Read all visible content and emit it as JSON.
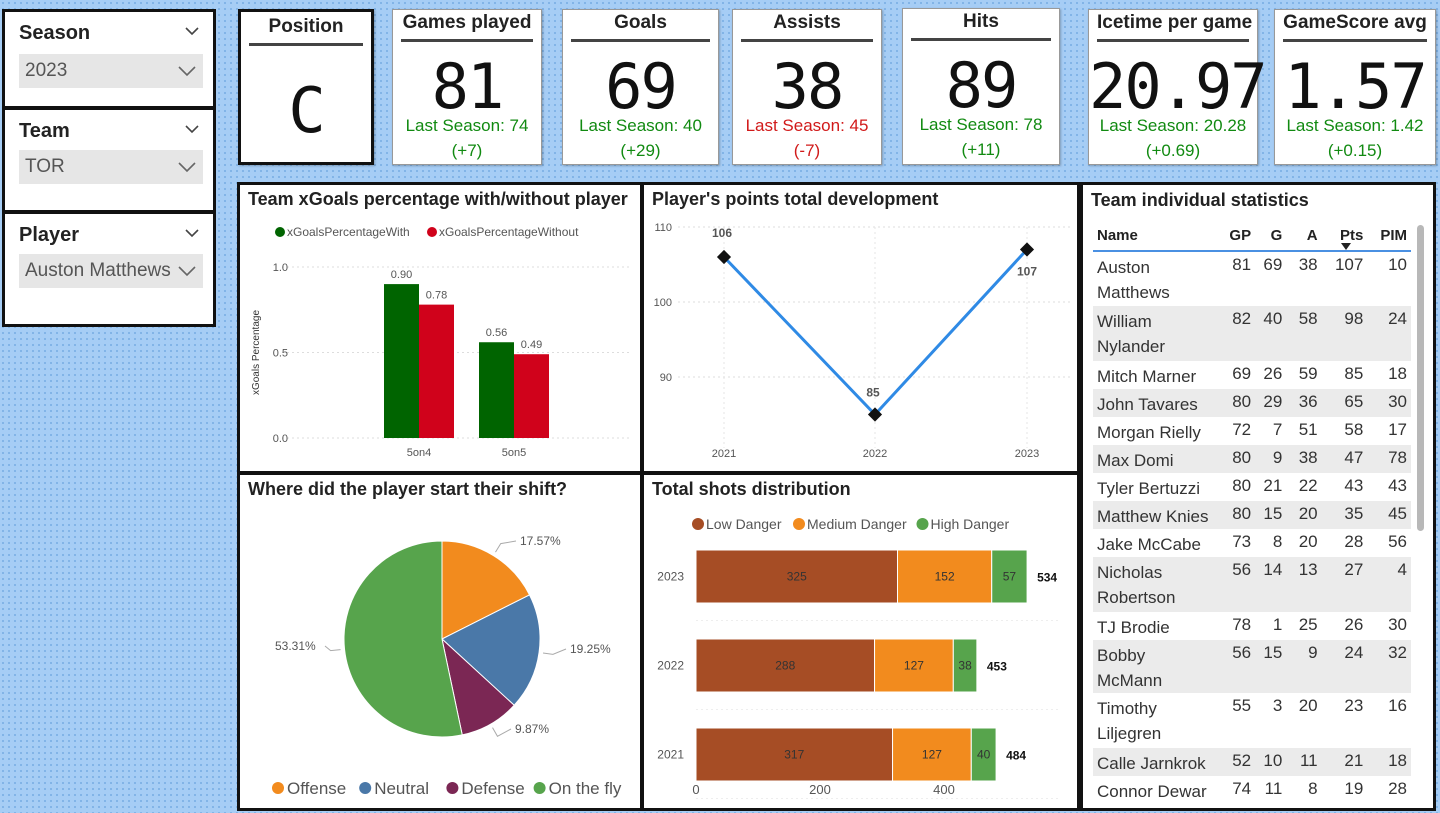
{
  "slicers": {
    "season": {
      "title": "Season",
      "value": "2023"
    },
    "team": {
      "title": "Team",
      "value": "TOR"
    },
    "player": {
      "title": "Player",
      "value": "Auston Matthews"
    }
  },
  "kpis": {
    "position": {
      "title": "Position",
      "value": "C"
    },
    "games": {
      "title": "Games played",
      "value": "81",
      "last": "Last Season: 74",
      "delta": "(+7)",
      "color": "#118a11"
    },
    "goals": {
      "title": "Goals",
      "value": "69",
      "last": "Last Season: 40",
      "delta": "(+29)",
      "color": "#118a11"
    },
    "assists": {
      "title": "Assists",
      "value": "38",
      "last": "Last Season: 45",
      "delta": "(-7)",
      "color": "#d11a1a"
    },
    "hits": {
      "title": "Hits",
      "value": "89",
      "last": "Last Season: 78",
      "delta": "(+11)",
      "color": "#118a11"
    },
    "icetime": {
      "title": "Icetime per game",
      "value": "20.97",
      "last": "Last Season: 20.28",
      "delta": "(+0.69)",
      "color": "#118a11"
    },
    "gamescore": {
      "title": "GameScore avg",
      "value": "1.57",
      "last": "Last Season: 1.42",
      "delta": "(+0.15)",
      "color": "#118a11"
    }
  },
  "table": {
    "title": "Team individual statistics",
    "columns": [
      "Name",
      "GP",
      "G",
      "A",
      "Pts",
      "PIM"
    ],
    "sort_column": "Pts",
    "rows": [
      [
        "Auston Matthews",
        "81",
        "69",
        "38",
        "107",
        "10"
      ],
      [
        "William Nylander",
        "82",
        "40",
        "58",
        "98",
        "24"
      ],
      [
        "Mitch Marner",
        "69",
        "26",
        "59",
        "85",
        "18"
      ],
      [
        "John Tavares",
        "80",
        "29",
        "36",
        "65",
        "30"
      ],
      [
        "Morgan Rielly",
        "72",
        "7",
        "51",
        "58",
        "17"
      ],
      [
        "Max Domi",
        "80",
        "9",
        "38",
        "47",
        "78"
      ],
      [
        "Tyler Bertuzzi",
        "80",
        "21",
        "22",
        "43",
        "43"
      ],
      [
        "Matthew Knies",
        "80",
        "15",
        "20",
        "35",
        "45"
      ],
      [
        "Jake McCabe",
        "73",
        "8",
        "20",
        "28",
        "56"
      ],
      [
        "Nicholas Robertson",
        "56",
        "14",
        "13",
        "27",
        "4"
      ],
      [
        "TJ Brodie",
        "78",
        "1",
        "25",
        "26",
        "30"
      ],
      [
        "Bobby McMann",
        "56",
        "15",
        "9",
        "24",
        "32"
      ],
      [
        "Timothy Liljegren",
        "55",
        "3",
        "20",
        "23",
        "16"
      ],
      [
        "Calle Jarnkrok",
        "52",
        "10",
        "11",
        "21",
        "18"
      ],
      [
        "Connor Dewar",
        "74",
        "11",
        "8",
        "19",
        "28"
      ]
    ]
  },
  "chart_data": [
    {
      "type": "bar",
      "title": "Team xGoals percentage with/without player",
      "ylabel": "xGoals Percentage",
      "xlabel": "",
      "categories": [
        "5on4",
        "5on5"
      ],
      "series": [
        {
          "name": "xGoalsPercentageWith",
          "color": "#006400",
          "values": [
            0.9,
            0.56
          ],
          "labels": [
            "0.90",
            "0.56"
          ]
        },
        {
          "name": "xGoalsPercentageWithout",
          "color": "#d0021b",
          "values": [
            0.78,
            0.49
          ],
          "labels": [
            "0.78",
            "0.49"
          ]
        }
      ],
      "ylim": [
        0,
        1.0
      ],
      "yticks": [
        "0.0",
        "0.5",
        "1.0"
      ],
      "legend": "top",
      "grid": true
    },
    {
      "type": "line",
      "title": "Player's points total development",
      "x": [
        "2021",
        "2022",
        "2023"
      ],
      "series": [
        {
          "color": "#2f8ae5",
          "values": [
            106,
            85,
            107
          ],
          "labels": [
            "106",
            "85",
            "107"
          ]
        }
      ],
      "ylim": [
        80,
        110
      ],
      "yticks": [
        "90",
        "100",
        "110"
      ],
      "grid": true
    },
    {
      "type": "pie",
      "title": "Where did the player start their shift?",
      "slices": [
        {
          "name": "Offense",
          "value": 17.57,
          "label": "17.57%",
          "color": "#f28b1e"
        },
        {
          "name": "Neutral",
          "value": 19.25,
          "label": "19.25%",
          "color": "#4a78a8"
        },
        {
          "name": "Defense",
          "value": 9.87,
          "label": "9.87%",
          "color": "#7b2754"
        },
        {
          "name": "On the fly",
          "value": 53.31,
          "label": "53.31%",
          "color": "#57a44c"
        }
      ],
      "legend": "bottom"
    },
    {
      "type": "bar",
      "orientation": "horizontal-stacked",
      "title": "Total shots distribution",
      "categories": [
        "2023",
        "2022",
        "2021"
      ],
      "series": [
        {
          "name": "Low Danger",
          "color": "#a64d25",
          "values": [
            325,
            288,
            317
          ]
        },
        {
          "name": "Medium Danger",
          "color": "#f28b1e",
          "values": [
            152,
            127,
            127
          ]
        },
        {
          "name": "High Danger",
          "color": "#57a44c",
          "values": [
            57,
            38,
            40
          ]
        }
      ],
      "totals": [
        "534",
        "453",
        "484"
      ],
      "xlim": [
        0,
        560
      ],
      "xticks": [
        "0",
        "200",
        "400"
      ],
      "legend": "top",
      "grid": true
    }
  ]
}
